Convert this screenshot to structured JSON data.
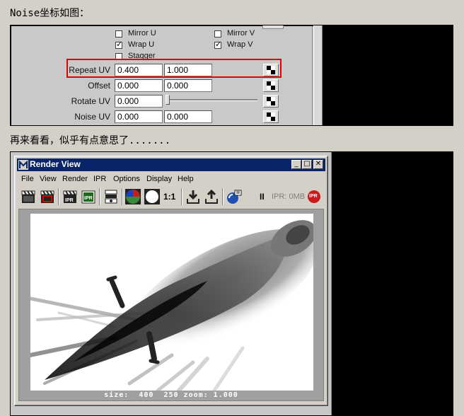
{
  "captions": {
    "top": "Noise坐标如图：",
    "middle": "再来看看，似乎有点意思了......."
  },
  "attributes": {
    "checkboxes": [
      {
        "label": "Mirror U",
        "checked": false
      },
      {
        "label": "Mirror V",
        "checked": false
      },
      {
        "label": "Wrap U",
        "checked": true
      },
      {
        "label": "Wrap V",
        "checked": true
      },
      {
        "label": "Stagger",
        "checked": false
      }
    ],
    "rows": [
      {
        "label": "Repeat UV",
        "u": "0.400",
        "v": "1.000"
      },
      {
        "label": "Offset",
        "u": "0.000",
        "v": "0.000"
      },
      {
        "label": "Rotate UV",
        "u": "0.000"
      },
      {
        "label": "Noise UV",
        "u": "0.000",
        "v": "0.000"
      }
    ],
    "highlight_color": "#e00000"
  },
  "render_view": {
    "title": "Render View",
    "window_buttons": [
      "_",
      "□",
      "✕"
    ],
    "menus": [
      "File",
      "View",
      "Render",
      "IPR",
      "Options",
      "Display",
      "Help"
    ],
    "toolbar": {
      "ratio": "1:1",
      "pause": "II",
      "ipr_memory": "IPR: 0MB",
      "ipr_badge": "IPR",
      "icons": [
        "render-clapper-icon",
        "render-region-icon",
        "ipr-render-icon",
        "ipr-refresh-icon",
        "snapshot-icon",
        "color-channels-icon",
        "alpha-channel-icon",
        "keep-image-icon",
        "remove-image-icon",
        "render-globals-icon"
      ]
    },
    "status": "size:  400  250 zoom: 1.000"
  },
  "colors": {
    "title_bar": "#0a246a",
    "window_bg": "#d4d0c8",
    "attr_bg": "#c9c9c9",
    "ipr_badge": "#cc1a1a"
  }
}
